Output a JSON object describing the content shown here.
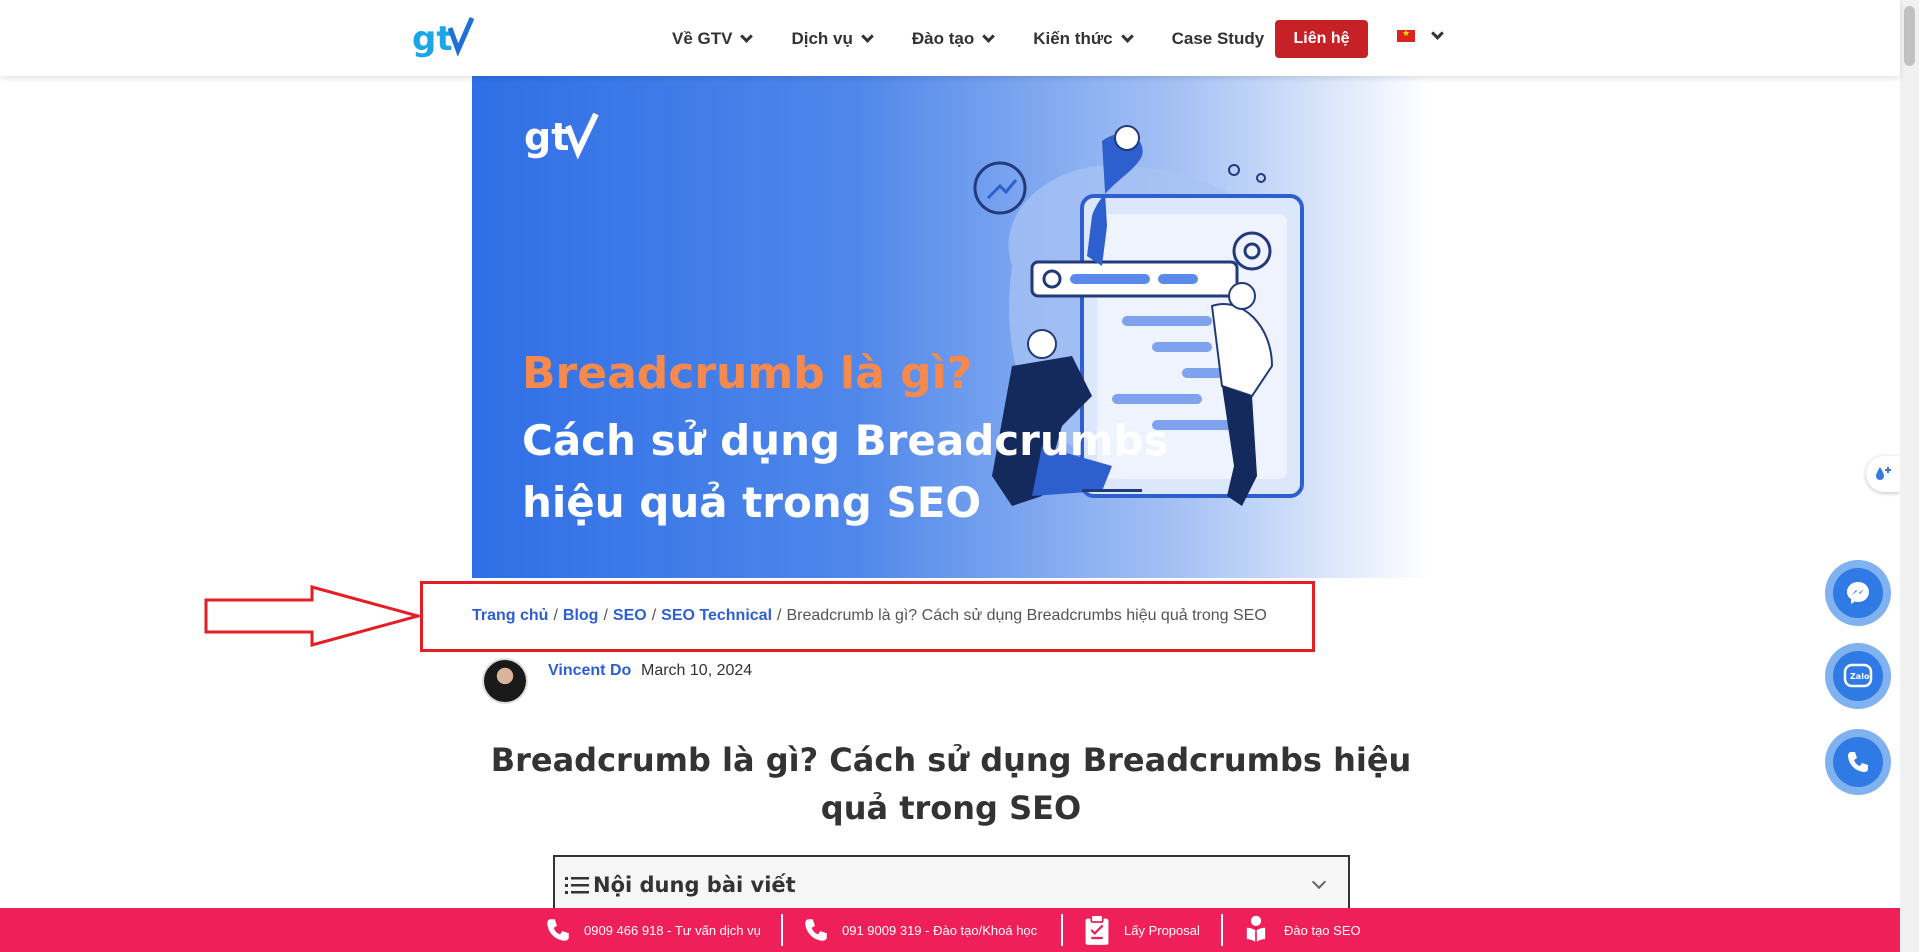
{
  "header": {
    "logo_text": "gtv",
    "nav": [
      {
        "label": "Về GTV"
      },
      {
        "label": "Dịch vụ"
      },
      {
        "label": "Đào tạo"
      },
      {
        "label": "Kiến thức"
      },
      {
        "label": "Case Study"
      }
    ],
    "contact_label": "Liên hệ",
    "language": "vi"
  },
  "hero": {
    "logo_text": "gtv",
    "title_line1": "Breadcrumb là gì?",
    "title_line2": "Cách sử dụng Breadcrumbs hiệu quả trong SEO"
  },
  "breadcrumb": {
    "home": "Trang chủ",
    "blog": "Blog",
    "seo": "SEO",
    "seo_technical": "SEO Technical",
    "current": "Breadcrumb là gì? Cách sử dụng Breadcrumbs hiệu quả trong SEO",
    "separator": "/"
  },
  "author": {
    "name": "Vincent Do",
    "date": "March 10, 2024"
  },
  "post": {
    "title": "Breadcrumb là gì? Cách sử dụng Breadcrumbs hiệu quả trong SEO"
  },
  "toc": {
    "title": "Nội dung bài viết"
  },
  "bottom_bar": {
    "items": [
      {
        "label": "0909 466 918 - Tư vấn dịch vụ",
        "icon": "phone-icon"
      },
      {
        "label": "091 9009 319 - Đào tạo/Khoá học",
        "icon": "phone-icon"
      },
      {
        "label": "Lấy Proposal",
        "icon": "clipboard-icon"
      },
      {
        "label": "Đào tạo SEO",
        "icon": "reading-person-icon"
      }
    ]
  },
  "floating": [
    "messenger-icon",
    "zalo-icon",
    "phone-icon"
  ],
  "colors": {
    "brand_blue": "#2d5fd3",
    "contact_red": "#c62127",
    "bottom_bar_pink": "#ef1f5a",
    "hero_orange": "#f5894e",
    "annotation_red": "#e31e24"
  }
}
